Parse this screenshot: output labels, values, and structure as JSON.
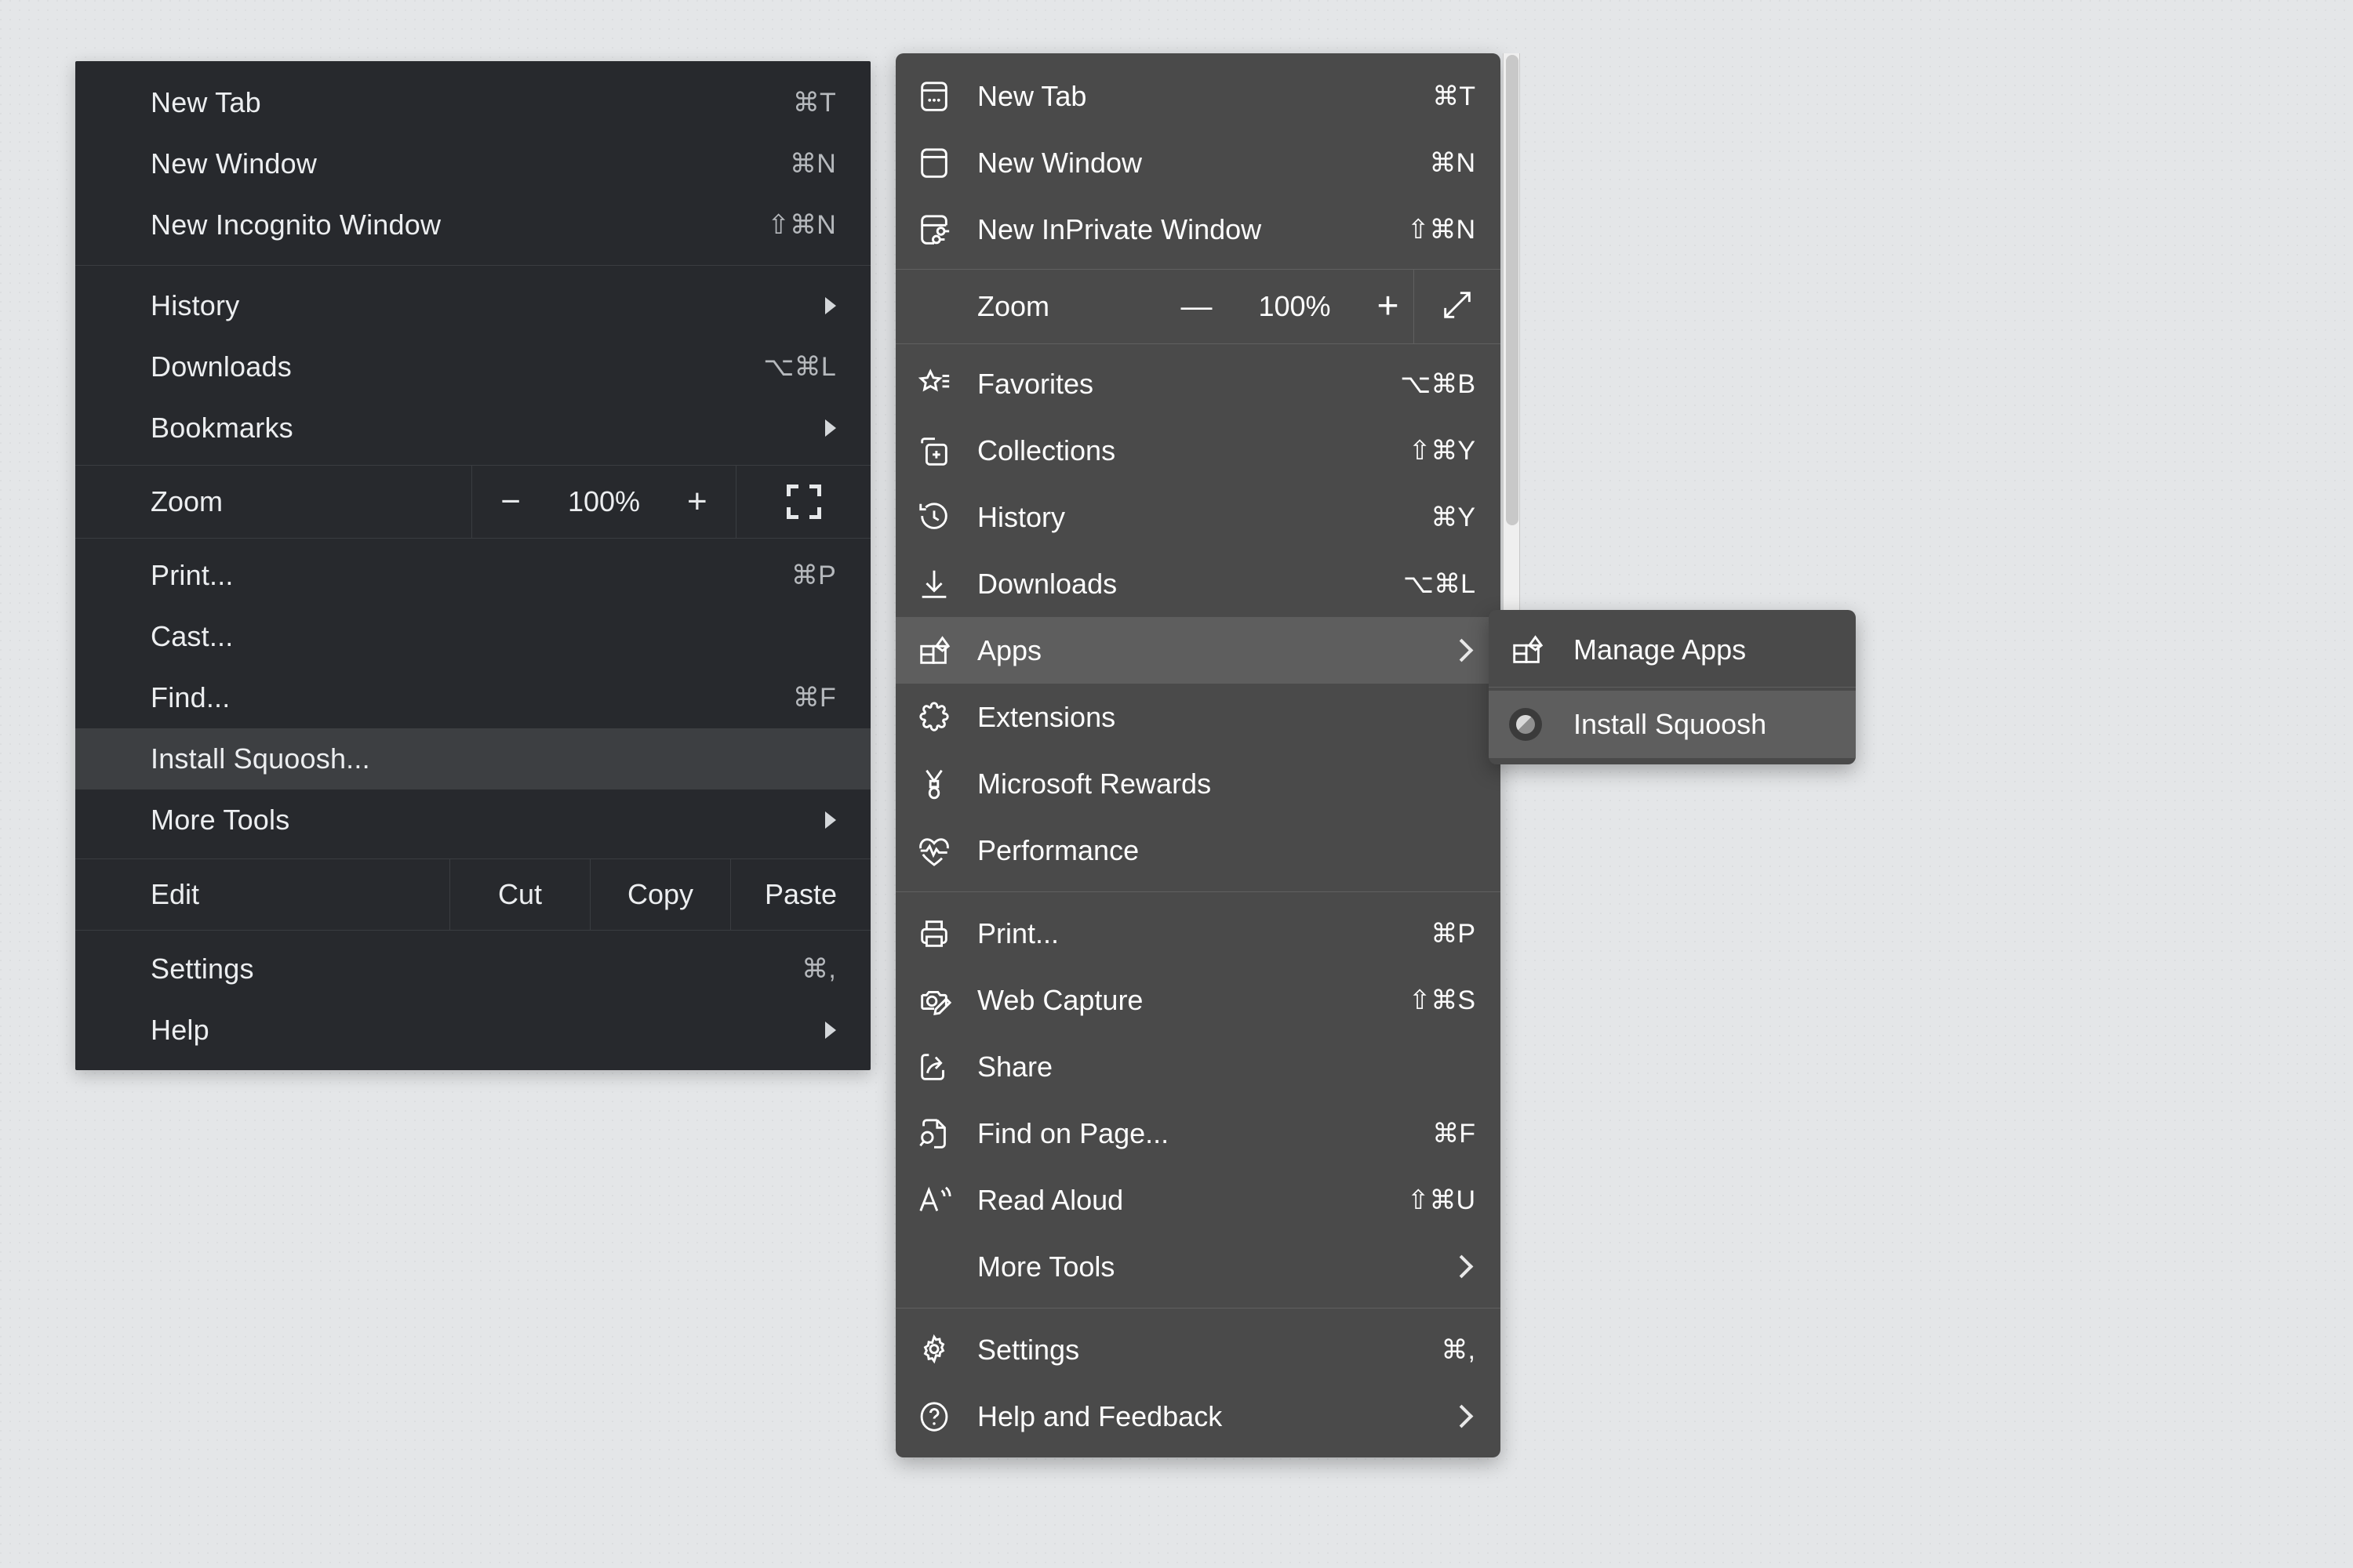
{
  "page": {
    "background_color": "#e4e6e8"
  },
  "chrome_menu": {
    "background_color": "#27292d",
    "highlight_color": "#3d3f42",
    "items": [
      {
        "label": "New Tab",
        "accel": "⌘T"
      },
      {
        "label": "New Window",
        "accel": "⌘N"
      },
      {
        "label": "New Incognito Window",
        "accel": "⇧⌘N"
      },
      {
        "label": "History",
        "accel": "",
        "submenu": true
      },
      {
        "label": "Downloads",
        "accel": "⌥⌘L"
      },
      {
        "label": "Bookmarks",
        "accel": "",
        "submenu": true
      },
      {
        "label": "Print...",
        "accel": "⌘P"
      },
      {
        "label": "Cast...",
        "accel": ""
      },
      {
        "label": "Find...",
        "accel": "⌘F"
      },
      {
        "label": "Install Squoosh...",
        "accel": "",
        "highlighted": true
      },
      {
        "label": "More Tools",
        "accel": "",
        "submenu": true
      },
      {
        "label": "Settings",
        "accel": "⌘,"
      },
      {
        "label": "Help",
        "accel": "",
        "submenu": true
      }
    ],
    "zoom_row": {
      "label": "Zoom",
      "minus": "−",
      "value": "100%",
      "plus": "+",
      "fullscreen_icon": "fullscreen-icon"
    },
    "edit_row": {
      "label": "Edit",
      "cut": "Cut",
      "copy": "Copy",
      "paste": "Paste"
    }
  },
  "edge_menu": {
    "background_color": "#4a4a4a",
    "highlight_color": "#5e5e5e",
    "items": [
      {
        "label": "New Tab",
        "accel": "⌘T",
        "icon": "new-tab-icon"
      },
      {
        "label": "New Window",
        "accel": "⌘N",
        "icon": "new-window-icon"
      },
      {
        "label": "New InPrivate Window",
        "accel": "⇧⌘N",
        "icon": "inprivate-window-icon"
      },
      {
        "label": "Favorites",
        "accel": "⌥⌘B",
        "icon": "favorites-star-icon"
      },
      {
        "label": "Collections",
        "accel": "⇧⌘Y",
        "icon": "collections-icon"
      },
      {
        "label": "History",
        "accel": "⌘Y",
        "icon": "history-clock-icon"
      },
      {
        "label": "Downloads",
        "accel": "⌥⌘L",
        "icon": "downloads-arrow-icon"
      },
      {
        "label": "Apps",
        "accel": "",
        "icon": "apps-grid-icon",
        "submenu": true,
        "highlighted": true
      },
      {
        "label": "Extensions",
        "accel": "",
        "icon": "extensions-puzzle-icon"
      },
      {
        "label": "Microsoft Rewards",
        "accel": "",
        "icon": "rewards-medal-icon"
      },
      {
        "label": "Performance",
        "accel": "",
        "icon": "performance-heartbeat-icon"
      },
      {
        "label": "Print...",
        "accel": "⌘P",
        "icon": "printer-icon"
      },
      {
        "label": "Web Capture",
        "accel": "⇧⌘S",
        "icon": "web-capture-icon"
      },
      {
        "label": "Share",
        "accel": "",
        "icon": "share-icon"
      },
      {
        "label": "Find on Page...",
        "accel": "⌘F",
        "icon": "find-on-page-icon"
      },
      {
        "label": "Read Aloud",
        "accel": "⇧⌘U",
        "icon": "read-aloud-icon"
      },
      {
        "label": "More Tools",
        "accel": "",
        "icon": "",
        "submenu": true
      },
      {
        "label": "Settings",
        "accel": "⌘,",
        "icon": "gear-icon"
      },
      {
        "label": "Help and Feedback",
        "accel": "",
        "icon": "help-circle-icon",
        "submenu": true
      }
    ],
    "zoom_row": {
      "label": "Zoom",
      "minus": "—",
      "value": "100%",
      "plus": "+",
      "expand_icon": "expand-diagonal-icon"
    }
  },
  "apps_submenu": {
    "background_color": "#4a4a4a",
    "highlight_color": "#5e5e5e",
    "items": [
      {
        "label": "Manage Apps",
        "icon": "apps-grid-icon"
      },
      {
        "label": "Install Squoosh",
        "icon": "squoosh-app-icon",
        "highlighted": true
      }
    ]
  }
}
